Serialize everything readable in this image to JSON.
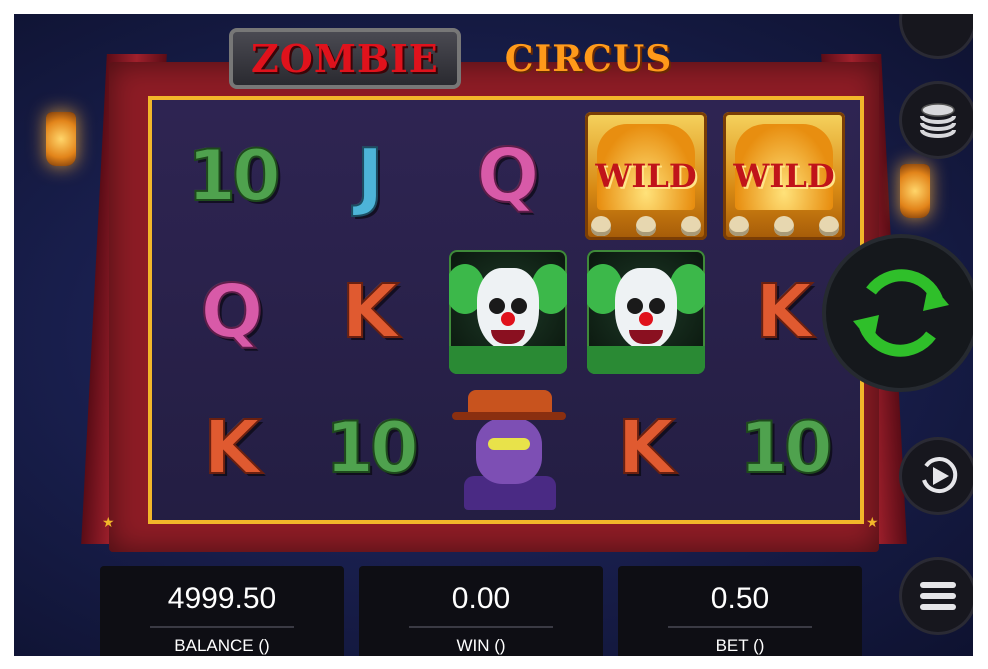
{
  "game": {
    "logo_left": "ZOMBIE",
    "logo_right": "CIRCUS"
  },
  "reels": {
    "rows": [
      [
        {
          "type": "letter",
          "text": "10",
          "color": "#4fa24e"
        },
        {
          "type": "letter",
          "text": "J",
          "color": "#4db4d8"
        },
        {
          "type": "letter",
          "text": "Q",
          "color": "#d85aa8"
        },
        {
          "type": "wild",
          "text": "WILD"
        },
        {
          "type": "wild",
          "text": "WILD"
        }
      ],
      [
        {
          "type": "letter",
          "text": "Q",
          "color": "#d85aa8"
        },
        {
          "type": "letter",
          "text": "K",
          "color": "#e05a30"
        },
        {
          "type": "clown-symbol"
        },
        {
          "type": "clown-symbol"
        },
        {
          "type": "letter",
          "text": "K",
          "color": "#e05a30"
        }
      ],
      [
        {
          "type": "letter",
          "text": "K",
          "color": "#e05a30"
        },
        {
          "type": "letter",
          "text": "10",
          "color": "#4fa24e"
        },
        {
          "type": "joker-symbol"
        },
        {
          "type": "letter",
          "text": "K",
          "color": "#e05a30"
        },
        {
          "type": "letter",
          "text": "10",
          "color": "#4fa24e"
        }
      ]
    ]
  },
  "panels": {
    "balance": {
      "value": "4999.50",
      "label": "BALANCE ()"
    },
    "win": {
      "value": "0.00",
      "label": "WIN ()"
    },
    "bet": {
      "value": "0.50",
      "label": "BET ()"
    }
  },
  "controls": {
    "coins_icon": "coin-stack-icon",
    "spin_icon": "spin-arrows-icon",
    "autoplay_icon": "play-icon",
    "menu_icon": "hamburger-menu-icon",
    "spin_color": "#2fbf2a"
  }
}
